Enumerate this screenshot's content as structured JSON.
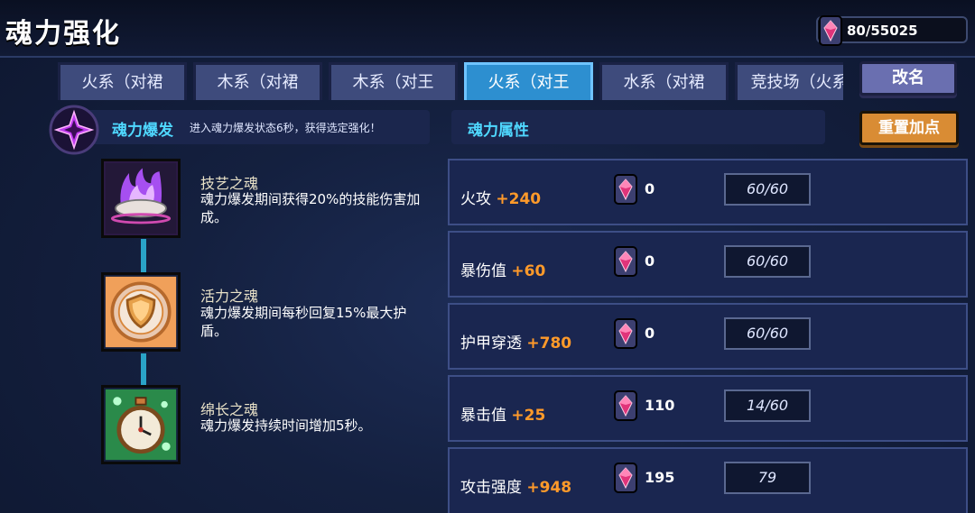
{
  "header": {
    "title": "魂力强化",
    "currency": "80/55025"
  },
  "tabs": [
    {
      "label": "火系（对裙",
      "active": false
    },
    {
      "label": "木系（对裙",
      "active": false
    },
    {
      "label": "木系（对王",
      "active": false
    },
    {
      "label": "火系（对王",
      "active": true
    },
    {
      "label": "水系（对裙",
      "active": false
    },
    {
      "label": "竞技场（火系",
      "active": false
    }
  ],
  "buttons": {
    "rename": "改名",
    "reset": "重置加点"
  },
  "burst": {
    "label": "魂力爆发",
    "desc": "进入魂力爆发状态6秒，获得选定强化！"
  },
  "souls": [
    {
      "name": "技艺之魂",
      "desc": "魂力爆发期间获得20%的技能伤害加成。",
      "icon": "purple-flame-icon"
    },
    {
      "name": "活力之魂",
      "desc": "魂力爆发期间每秒回复15%最大护盾。",
      "icon": "shield-icon"
    },
    {
      "name": "绵长之魂",
      "desc": "魂力爆发持续时间增加5秒。",
      "icon": "stopwatch-icon"
    }
  ],
  "attributes": {
    "header": "魂力属性",
    "rows": [
      {
        "name": "火攻",
        "bonus": "+240",
        "count": "0",
        "value": "60/60"
      },
      {
        "name": "暴伤值",
        "bonus": "+60",
        "count": "0",
        "value": "60/60"
      },
      {
        "name": "护甲穿透",
        "bonus": "+780",
        "count": "0",
        "value": "60/60"
      },
      {
        "name": "暴击值",
        "bonus": "+25",
        "count": "110",
        "value": "14/60"
      },
      {
        "name": "攻击强度",
        "bonus": "+948",
        "count": "195",
        "value": "79"
      }
    ]
  },
  "colors": {
    "accent": "#4fd8ff",
    "bonus": "#ff9a2a",
    "active_tab": "#2d8fd0",
    "reset_button": "#d98c34"
  }
}
